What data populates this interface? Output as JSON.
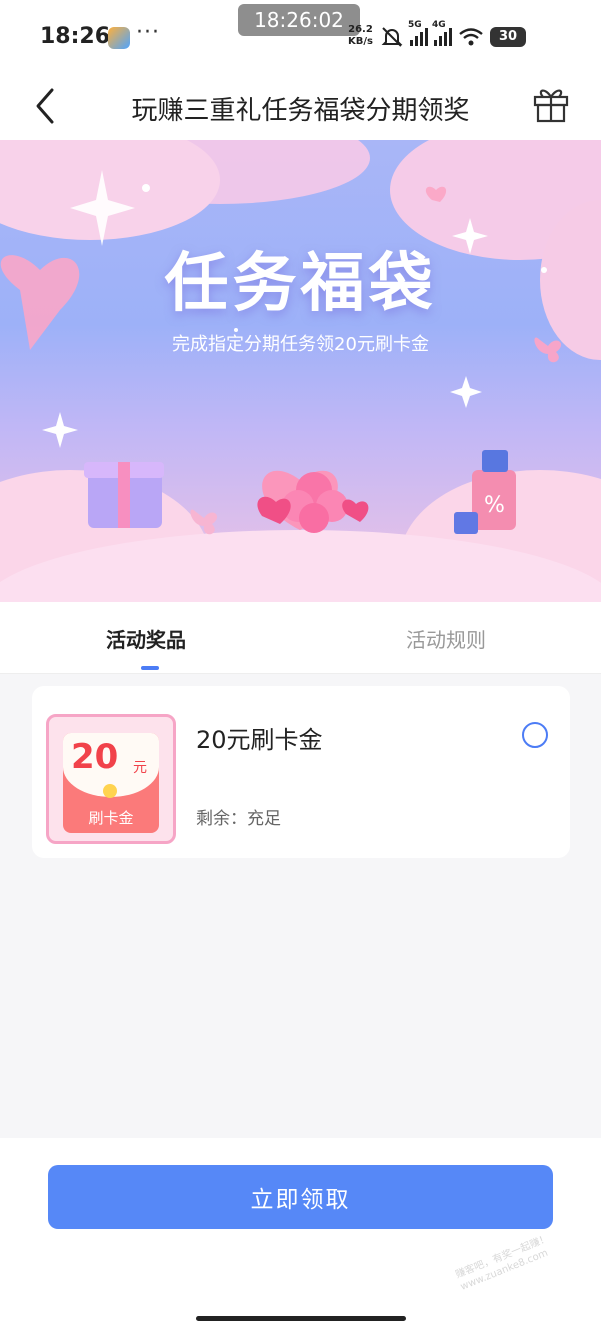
{
  "status_bar": {
    "time": "18:26",
    "more_dots": "···",
    "clock_pill": "18:26:02",
    "net_speed_value": "26.2",
    "net_speed_unit": "KB/s",
    "sim1_label": "5G",
    "sim2_label": "4G",
    "battery": "30"
  },
  "nav": {
    "title": "玩赚三重礼任务福袋分期领奖"
  },
  "banner": {
    "title": "任务福袋",
    "subtitle": "完成指定分期任务领20元刷卡金"
  },
  "tabs": [
    {
      "label": "活动奖品",
      "active": true
    },
    {
      "label": "活动规则",
      "active": false
    }
  ],
  "prize": {
    "image_amount": "20",
    "image_unit": "元",
    "image_label": "刷卡金",
    "name": "20元刷卡金",
    "stock_text": "剩余：充足",
    "selected": false
  },
  "footer": {
    "claim_button_label": "立即领取",
    "watermark_line1": "赚客吧，有奖一起赚！",
    "watermark_line2": "www.zuanke8.com"
  },
  "colors": {
    "accent": "#5688f7",
    "tab_indicator": "#4c7cf5",
    "prize_red": "#f1424a"
  },
  "icons": {
    "back": "chevron-left-icon",
    "gift": "gift-icon"
  }
}
